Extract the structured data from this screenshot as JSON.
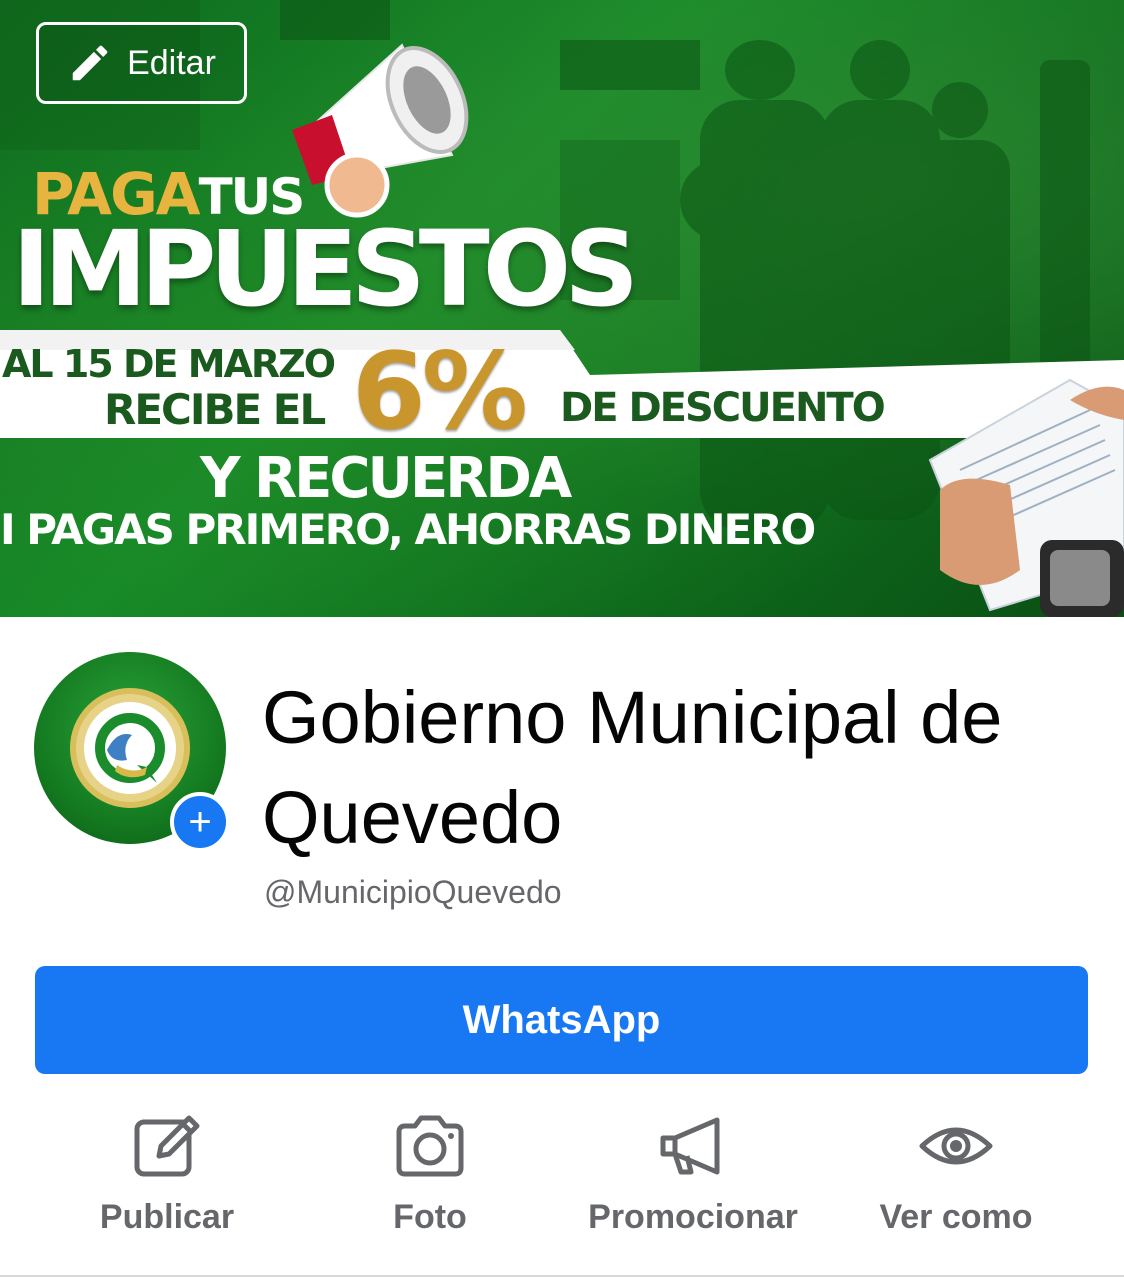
{
  "cover": {
    "edit_label": "Editar",
    "paga": "PAGA",
    "tus": "TUS",
    "impuestos": "IMPUESTOS",
    "fecha": "AL 15 DE MARZO",
    "recibe": "RECIBE EL",
    "porcentaje": "6%",
    "descuento": "DE DESCUENTO",
    "recuerda": "Y RECUERDA",
    "slogan": "I PAGAS PRIMERO, AHORRAS DINERO"
  },
  "profile": {
    "name": "Gobierno Municipal de Quevedo",
    "handle": "@MunicipioQuevedo",
    "add_symbol": "+"
  },
  "cta": {
    "label": "WhatsApp"
  },
  "actions": [
    {
      "label": "Publicar",
      "icon": "compose-icon"
    },
    {
      "label": "Foto",
      "icon": "camera-icon"
    },
    {
      "label": "Promocionar",
      "icon": "megaphone-icon"
    },
    {
      "label": "Ver como",
      "icon": "eye-icon"
    }
  ],
  "colors": {
    "brand_blue": "#1877f2",
    "cover_green": "#178a28",
    "gold": "#e8b440",
    "muted_text": "#65676b"
  }
}
